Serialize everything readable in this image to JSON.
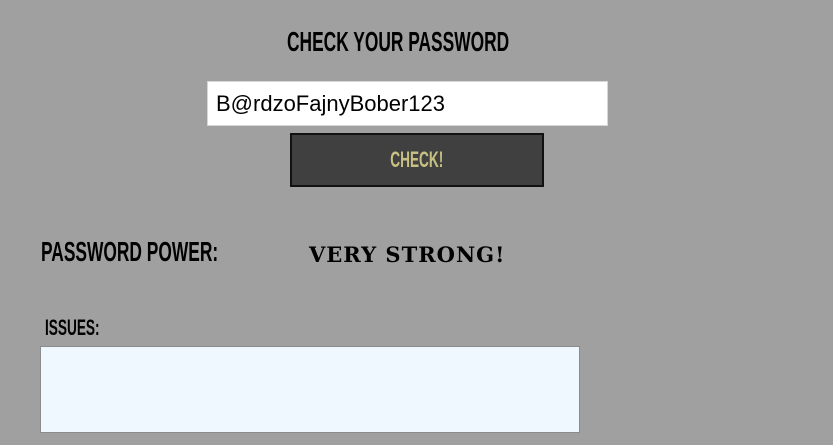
{
  "title": "CHECK YOUR PASSWORD",
  "password_field": {
    "value": "B@rdzoFajnyBober123"
  },
  "check_button": {
    "label": "CHECK!"
  },
  "password_power": {
    "label": "PASSWORD POWER:",
    "value": "VERY STRONG!"
  },
  "issues": {
    "label": "ISSUES:",
    "value": ""
  },
  "colors": {
    "background": "#a0a0a0",
    "button_background": "#404040",
    "button_text": "#c8c083",
    "issues_background": "#f0f8ff"
  }
}
